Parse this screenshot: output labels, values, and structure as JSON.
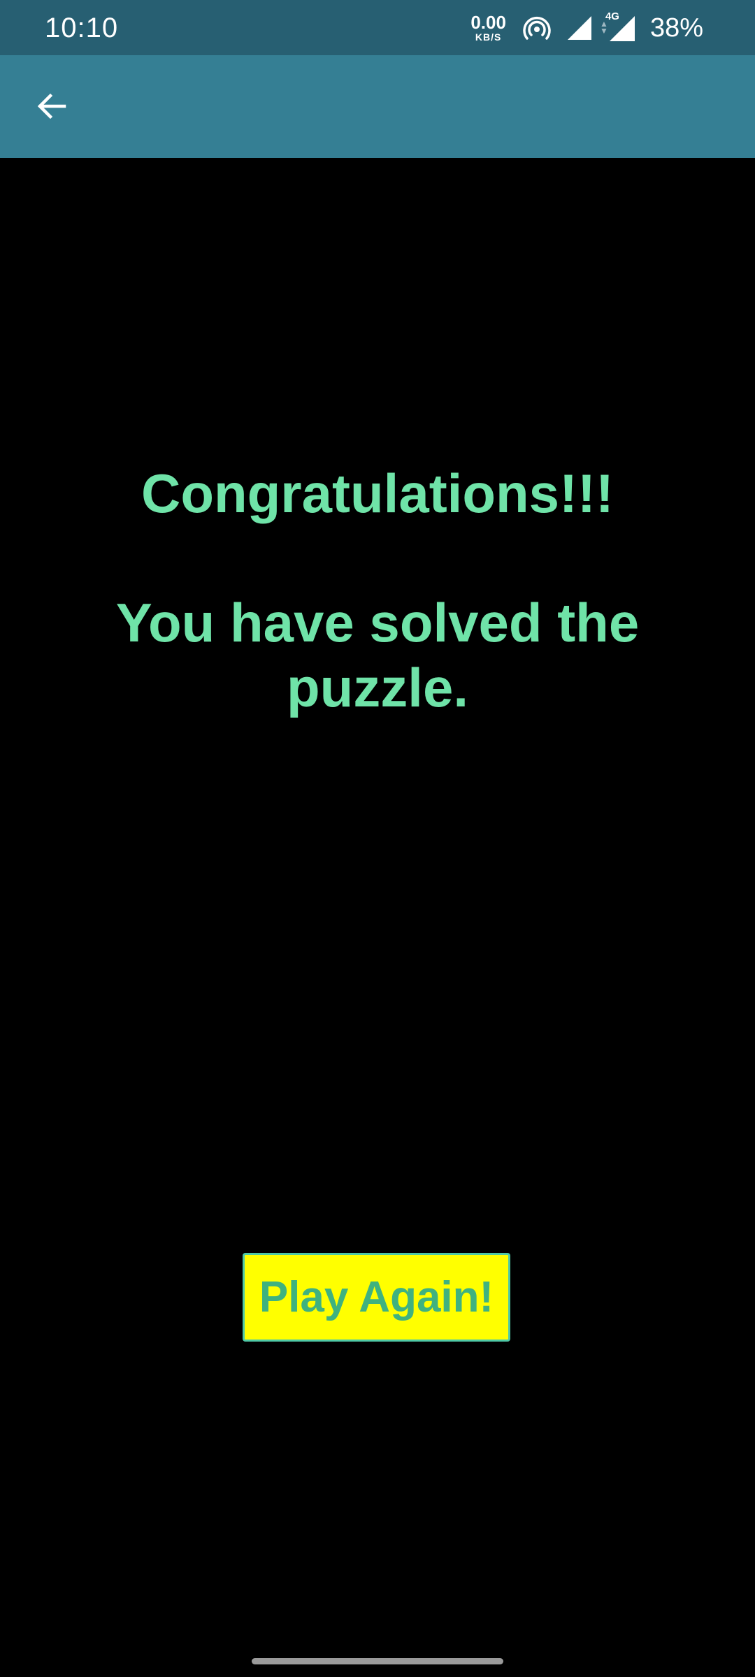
{
  "status_bar": {
    "time": "10:10",
    "net_speed_value": "0.00",
    "net_speed_unit": "KB/S",
    "network_type": "4G",
    "battery": "38%",
    "icons": [
      "hotspot-icon",
      "signal-icon",
      "signal-4g-icon"
    ]
  },
  "app_bar": {
    "back_icon": "arrow-back-icon"
  },
  "content": {
    "congrats": "Congratulations!!!",
    "solved": "You have solved the puzzle."
  },
  "button": {
    "play_again": "Play Again!"
  },
  "colors": {
    "status_bar_bg": "#275f72",
    "app_bar_bg": "#357f94",
    "message_text": "#6fe3a8",
    "button_bg": "#ffff00",
    "button_text": "#3fb27f",
    "background": "#000000"
  }
}
